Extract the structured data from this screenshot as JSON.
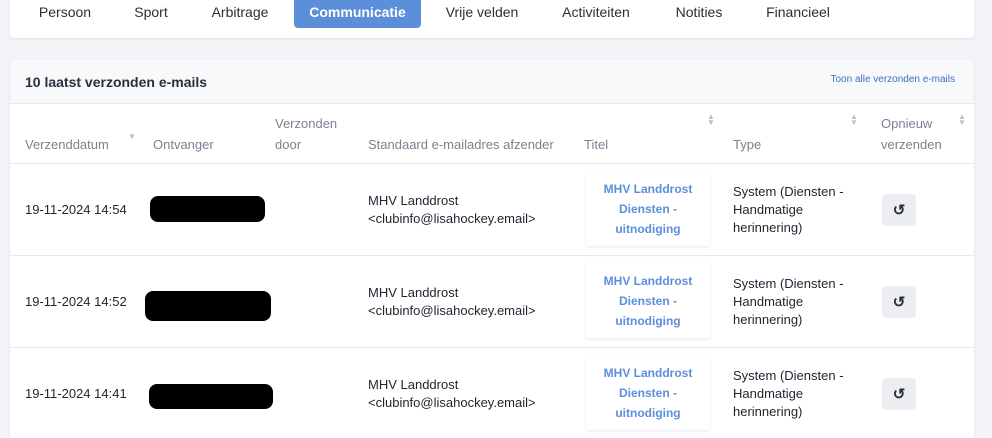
{
  "tabs": [
    {
      "label": "Persoon",
      "active": false
    },
    {
      "label": "Sport",
      "active": false
    },
    {
      "label": "Arbitrage",
      "active": false
    },
    {
      "label": "Communicatie",
      "active": true
    },
    {
      "label": "Vrije velden",
      "active": false
    },
    {
      "label": "Activiteiten",
      "active": false
    },
    {
      "label": "Notities",
      "active": false
    },
    {
      "label": "Financieel",
      "active": false
    }
  ],
  "card": {
    "title": "10 laatst verzonden e-mails",
    "show_all": "Toon alle verzonden e-mails"
  },
  "columns": {
    "date": "Verzenddatum",
    "recipient": "Ontvanger",
    "sent_by_1": "Verzonden",
    "sent_by_2": "door",
    "sender": "Standaard e-mailadres afzender",
    "title": "Titel",
    "type": "Type",
    "resend_1": "Opnieuw",
    "resend_2": "verzenden"
  },
  "rows": [
    {
      "date": "19-11-2024 14:54",
      "sender_name": "MHV Landdrost",
      "sender_email": "<clubinfo@lisahockey.email>",
      "title_1": "MHV Landdrost",
      "title_2": "Diensten -",
      "title_3": "uitnodiging",
      "type_1": "System (Diensten -",
      "type_2": "Handmatige",
      "type_3": "herinnering)",
      "resend_icon": "↺"
    },
    {
      "date": "19-11-2024 14:52",
      "sender_name": "MHV Landdrost",
      "sender_email": "<clubinfo@lisahockey.email>",
      "title_1": "MHV Landdrost",
      "title_2": "Diensten -",
      "title_3": "uitnodiging",
      "type_1": "System (Diensten -",
      "type_2": "Handmatige",
      "type_3": "herinnering)",
      "resend_icon": "↺"
    },
    {
      "date": "19-11-2024 14:41",
      "sender_name": "MHV Landdrost",
      "sender_email": "<clubinfo@lisahockey.email>",
      "title_1": "MHV Landdrost",
      "title_2": "Diensten -",
      "title_3": "uitnodiging",
      "type_1": "System (Diensten -",
      "type_2": "Handmatige",
      "type_3": "herinnering)",
      "resend_icon": "↺"
    }
  ],
  "colors": {
    "accent": "#5b8fd9",
    "link": "#3d6fc0"
  }
}
